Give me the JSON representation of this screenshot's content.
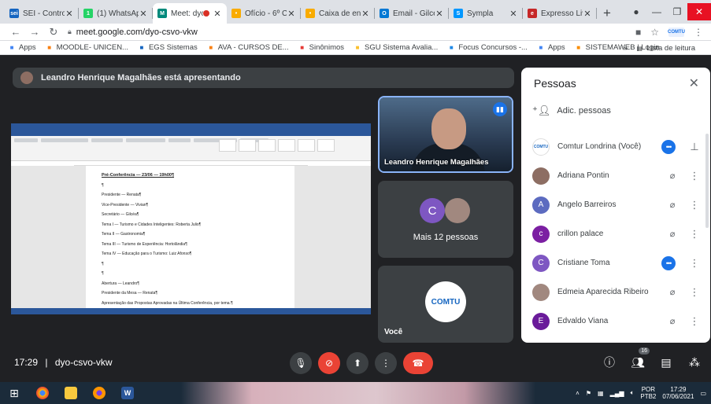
{
  "browser": {
    "tabs": [
      {
        "label": "SEI - Controle",
        "icon": "sei-icon",
        "color": "#1565c0",
        "glyph": "sei",
        "active": false
      },
      {
        "label": "(1) WhatsApp",
        "icon": "whatsapp-icon",
        "color": "#25d366",
        "glyph": "1",
        "active": false
      },
      {
        "label": "Meet: dyo",
        "icon": "meet-icon",
        "color": "#00897b",
        "glyph": "M",
        "active": true,
        "recording": true
      },
      {
        "label": "Ofício - 6º Co",
        "icon": "doc-icon",
        "color": "#f9ab00",
        "glyph": "•",
        "active": false
      },
      {
        "label": "Caixa de entr",
        "icon": "mail-icon",
        "color": "#f9ab00",
        "glyph": "•",
        "active": false
      },
      {
        "label": "Email - Gilce",
        "icon": "outlook-icon",
        "color": "#0078d4",
        "glyph": "O",
        "active": false
      },
      {
        "label": "Sympla",
        "icon": "sympla-icon",
        "color": "#0097ff",
        "glyph": "S",
        "active": false
      },
      {
        "label": "Expresso Livr",
        "icon": "expresso-icon",
        "color": "#c62828",
        "glyph": "e",
        "active": false
      }
    ],
    "new_tab": "+",
    "url": "meet.google.com/dyo-csvo-vkw"
  },
  "bookmarks": {
    "items": [
      {
        "label": "Apps",
        "icon": "apps-grid-icon",
        "color": "#4285f4"
      },
      {
        "label": "MOODLE- UNICEN...",
        "icon": "moodle-icon",
        "color": "#f98012"
      },
      {
        "label": "EGS Sistemas",
        "icon": "egs-icon",
        "color": "#1565c0"
      },
      {
        "label": "AVA - CURSOS DE...",
        "icon": "moodle-icon",
        "color": "#f98012"
      },
      {
        "label": "Sinônimos",
        "icon": "sinonimos-icon",
        "color": "#e53935"
      },
      {
        "label": "SGU Sistema Avalia...",
        "icon": "sgu-icon",
        "color": "#fbc02d"
      },
      {
        "label": "Focus Concursos -...",
        "icon": "focus-icon",
        "color": "#1e88e5"
      },
      {
        "label": "Apps",
        "icon": "apps-grid-icon",
        "color": "#4285f4"
      },
      {
        "label": "SISTEMAWEB | Login",
        "icon": "sistemaweb-icon",
        "color": "#fb8c00"
      }
    ],
    "more": "»",
    "reading_list": "Lista de leitura"
  },
  "meet": {
    "presenting_text": "Leandro Henrique Magalhães está apresentando",
    "main_tile_name": "Leandro Henrique Magalhães",
    "more_people_initial": "C",
    "more_people_label": "Mais 12 pessoas",
    "you_label": "Você",
    "you_logo_text": "COMTU",
    "time": "17:29",
    "separator": "|",
    "meeting_code": "dyo-csvo-vkw",
    "participants_count": "16"
  },
  "document": {
    "lines": [
      {
        "text": "Pré-Conferência — 23/06 — 19h00¶",
        "bold": true
      },
      {
        "text": "¶",
        "bold": false
      },
      {
        "text": "Presidente — Renata¶",
        "bold": false
      },
      {
        "text": "Vice-Presidente — Vivian¶",
        "bold": false
      },
      {
        "text": "Secretário — Gilcéa¶",
        "bold": false
      },
      {
        "text": "Tema I — Turismo e Cidades Inteligentes: Roberta Julio¶",
        "bold": false
      },
      {
        "text": "Tema II — Gastronomia¶",
        "bold": false
      },
      {
        "text": "Tema III — Turismo de Experiência: Hortolândia¶",
        "bold": false
      },
      {
        "text": "Tema IV — Educação para o Turismo: Luiz Afonso¶",
        "bold": false
      },
      {
        "text": "¶",
        "bold": false
      },
      {
        "text": "¶",
        "bold": false
      },
      {
        "text": "Abertura — Leandro¶",
        "bold": false
      },
      {
        "text": "Presidente da Mesa — Renata¶",
        "bold": false
      },
      {
        "text": "Apresentação das Propostas Aprovadas na Última Conferência, por tema.¶",
        "bold": false
      }
    ]
  },
  "people": {
    "title": "Pessoas",
    "add_label": "Adic. pessoas",
    "list": [
      {
        "name": "Comtur Londrina (Você)",
        "initial": "",
        "color": "#ffffff",
        "state": "speaking",
        "pin": true
      },
      {
        "name": "Adriana Pontin",
        "initial": "",
        "color": "#8d6e63",
        "state": "muted",
        "pin": false
      },
      {
        "name": "Angelo Barreiros",
        "initial": "A",
        "color": "#5c6bc0",
        "state": "muted",
        "pin": false
      },
      {
        "name": "crillon palace",
        "initial": "c",
        "color": "#7b1fa2",
        "state": "muted",
        "pin": false
      },
      {
        "name": "Cristiane Toma",
        "initial": "C",
        "color": "#7e57c2",
        "state": "speaking",
        "pin": false
      },
      {
        "name": "Edmeia Aparecida Ribeiro",
        "initial": "",
        "color": "#a1887f",
        "state": "muted",
        "pin": false
      },
      {
        "name": "Edvaldo Viana",
        "initial": "E",
        "color": "#6a1b9a",
        "state": "muted",
        "pin": false
      }
    ]
  },
  "taskbar": {
    "lang": "POR",
    "layout": "PTB2",
    "time": "17:29",
    "date": "07/06/2021"
  },
  "colors": {
    "meet_bg": "#202124",
    "accent_blue": "#1a73e8",
    "hangup_red": "#ea4335"
  }
}
